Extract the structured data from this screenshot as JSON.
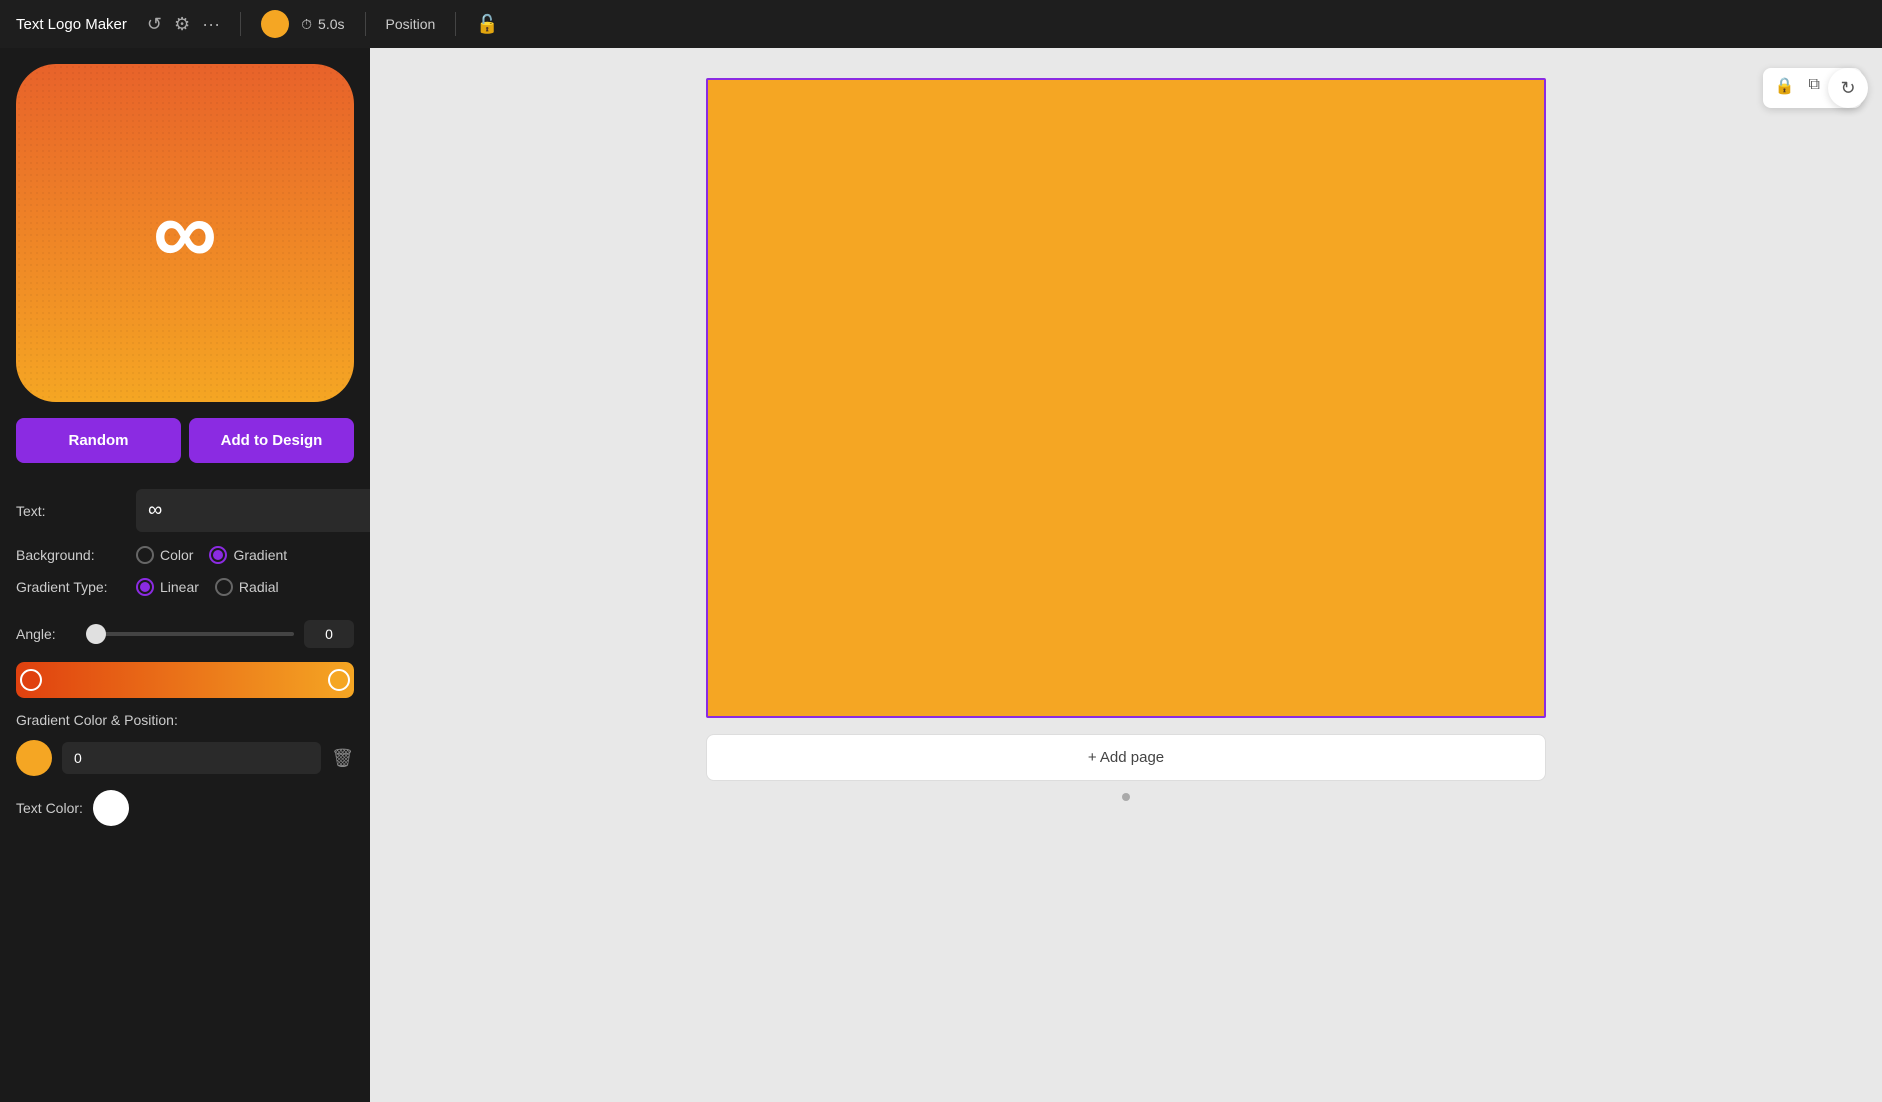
{
  "app": {
    "title": "Text Logo Maker"
  },
  "topbar": {
    "time_label": "5.0s",
    "position_label": "Position"
  },
  "panel": {
    "random_label": "Random",
    "add_to_design_label": "Add to Design",
    "text_label": "Text:",
    "text_value": "∞",
    "background_label": "Background:",
    "color_option": "Color",
    "gradient_option": "Gradient",
    "gradient_type_label": "Gradient Type:",
    "linear_option": "Linear",
    "radial_option": "Radial",
    "angle_label": "Angle:",
    "angle_value": "0",
    "gradient_color_position_label": "Gradient Color & Position:",
    "position_value": "0",
    "text_color_label": "Text Color:"
  },
  "canvas": {
    "add_page_label": "+ Add page"
  }
}
